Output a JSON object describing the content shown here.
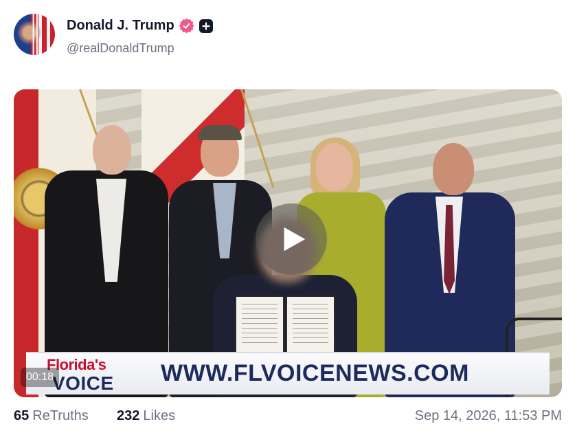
{
  "author": {
    "display_name": "Donald J. Trump",
    "handle": "@realDonaldTrump",
    "verified_badge_color": "#f05a8a"
  },
  "video": {
    "duration": "00:18",
    "banner": {
      "logo_line1": "Florida's",
      "logo_line2": "VOICE",
      "url_text": "WWW.FLVOICENEWS.COM"
    }
  },
  "stats": {
    "retruths_count": "65",
    "retruths_label": "ReTruths",
    "likes_count": "232",
    "likes_label": "Likes"
  },
  "posted_at": "Sep 14, 2026, 11:53 PM"
}
